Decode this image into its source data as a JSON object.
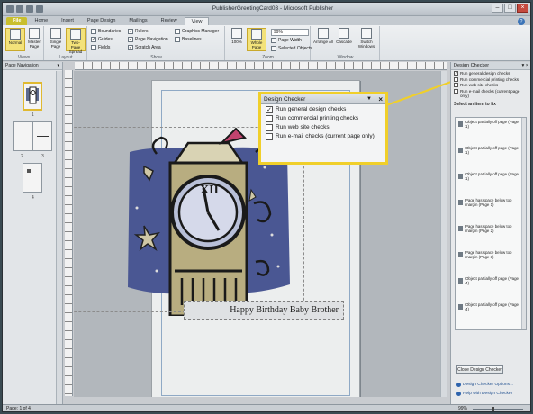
{
  "window": {
    "title": "PublisherGreetingCard03 - Microsoft Publisher"
  },
  "tabs": [
    "File",
    "Home",
    "Insert",
    "Page Design",
    "Mailings",
    "Review",
    "View"
  ],
  "active_tab": "View",
  "ribbon": {
    "views": {
      "name": "Views",
      "normal": "Normal",
      "master": "Master Page"
    },
    "layout": {
      "name": "Layout",
      "single": "Single Page",
      "two": "Two-Page Spread"
    },
    "show": {
      "name": "Show",
      "items": [
        "Boundaries",
        "Guides",
        "Fields",
        "Rulers",
        "Page Navigation",
        "Scratch Area",
        "Graphics Manager",
        "Baselines"
      ]
    },
    "zoom": {
      "name": "Zoom",
      "value": "99%",
      "page_width": "Page Width",
      "selected": "Selected Objects",
      "hundred": "100%",
      "whole": "Whole Page"
    },
    "window": {
      "name": "Window",
      "arrange": "Arrange All",
      "cascade": "Cascade",
      "switch": "Switch Windows"
    }
  },
  "page_nav": {
    "title": "Page Navigation",
    "pages": [
      "1",
      "2",
      "3",
      "4"
    ]
  },
  "document": {
    "caption": "Happy Birthday Baby Brother"
  },
  "callout": {
    "title": "Design Checker",
    "options": [
      {
        "label": "Run general design checks",
        "checked": true
      },
      {
        "label": "Run commercial printing checks",
        "checked": false
      },
      {
        "label": "Run web site checks",
        "checked": false
      },
      {
        "label": "Run e-mail checks (current page only)",
        "checked": false
      }
    ]
  },
  "design_checker": {
    "title": "Design Checker",
    "options": [
      {
        "label": "Run general design checks",
        "checked": true
      },
      {
        "label": "Run commercial printing checks",
        "checked": false
      },
      {
        "label": "Run web site checks",
        "checked": false
      },
      {
        "label": "Run e-mail checks (current page only)",
        "checked": false
      }
    ],
    "select_label": "Select an item to fix",
    "items": [
      "Object partially off page (Page 1)",
      "Object partially off page (Page 1)",
      "Object partially off page (Page 1)",
      "Page has space below top margin (Page 1)",
      "Page has space below top margin (Page 2)",
      "Page has space below top margin (Page 3)",
      "Object partially off page (Page 4)",
      "Object partially off page (Page 4)"
    ],
    "close_button": "Close Design Checker",
    "options_link": "Design Checker Options...",
    "help_link": "Help with Design Checker"
  },
  "status": {
    "page": "Page: 1 of 4",
    "zoom": "99%"
  },
  "colors": {
    "accent": "#f0cf2a",
    "file_tab": "#c9bf2d"
  }
}
